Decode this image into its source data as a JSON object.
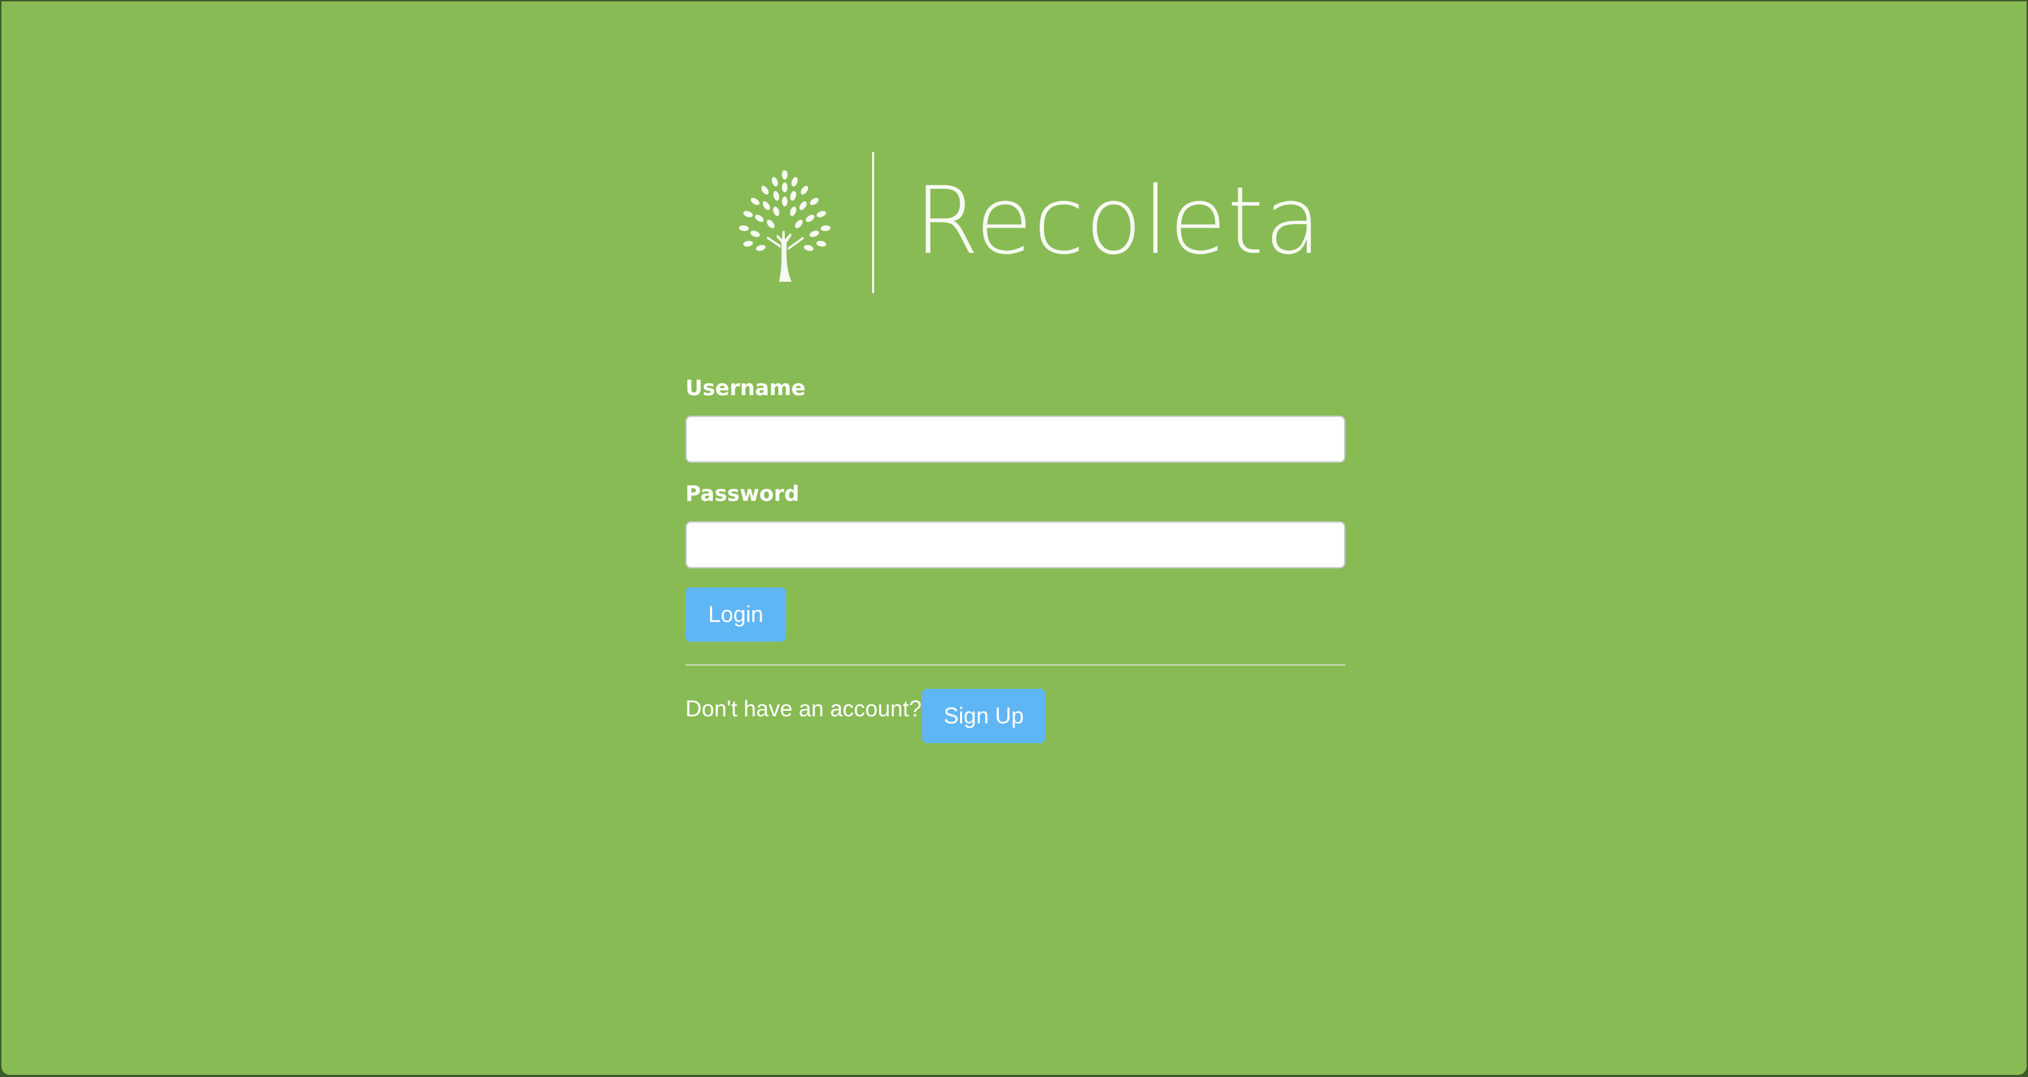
{
  "brand": {
    "name": "Recoleta",
    "logo_icon": "tree-icon"
  },
  "login_form": {
    "username_label": "Username",
    "username_value": "",
    "password_label": "Password",
    "password_value": "",
    "login_button": "Login"
  },
  "signup": {
    "prompt": "Don't have an account?",
    "button": "Sign Up"
  },
  "colors": {
    "background": "#88bb54",
    "button": "#5fb6f5",
    "text": "#ffffff"
  }
}
